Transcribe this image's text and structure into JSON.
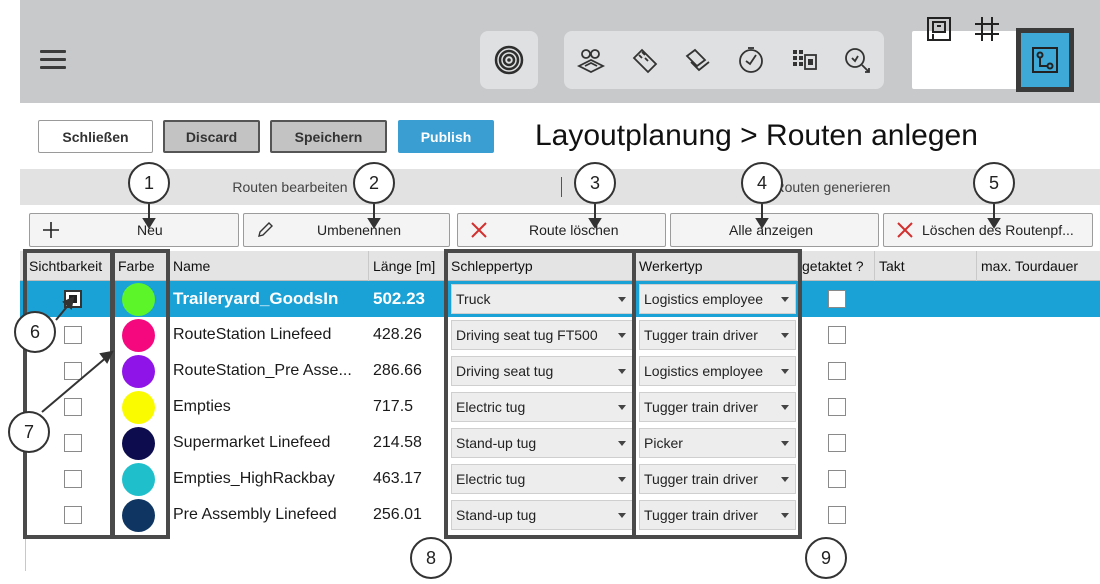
{
  "toolbar": {
    "menu_icon": "hamburger-icon",
    "group1": [
      "radar-icon"
    ],
    "group2": [
      "shapes-icon",
      "ruler-icon",
      "layers-icon",
      "clock-icon",
      "grid-table-icon",
      "search-route-icon"
    ],
    "views": [
      "floorplan-view-icon",
      "grid-view-icon",
      "route-view-icon"
    ],
    "active_view": "route-view-icon"
  },
  "actions": {
    "close": "Schließen",
    "discard": "Discard",
    "save": "Speichern",
    "publish": "Publish"
  },
  "page_title": "Layoutplanung > Routen anlegen",
  "tabs": {
    "edit": "Routen bearbeiten",
    "generate": "Routen generieren"
  },
  "route_toolbar": {
    "new": "Neu",
    "rename": "Umbenennen",
    "delete_route": "Route löschen",
    "show_all": "Alle anzeigen",
    "delete_path": "Löschen des Routenpf..."
  },
  "columns": {
    "visibility": "Sichtbarkeit",
    "color": "Farbe",
    "name": "Name",
    "length": "Länge [m]",
    "tug_type": "Schleppertyp",
    "worker_type": "Werkertyp",
    "clocked": "getaktet ?",
    "cycle": "Takt",
    "max_tour": "max. Tourdauer"
  },
  "rows": [
    {
      "visible": true,
      "color": "#5cf52a",
      "name": "Traileryard_GoodsIn",
      "length": "502.23",
      "tug": "Truck",
      "worker": "Logistics employee",
      "clocked": false,
      "selected": true
    },
    {
      "visible": false,
      "color": "#f5087e",
      "name": "RouteStation Linefeed",
      "length": "428.26",
      "tug": "Driving seat tug FT500",
      "worker": "Tugger train driver",
      "clocked": false,
      "selected": false
    },
    {
      "visible": false,
      "color": "#8e14e8",
      "name": "RouteStation_Pre Asse...",
      "length": "286.66",
      "tug": "Driving seat tug",
      "worker": "Logistics employee",
      "clocked": false,
      "selected": false
    },
    {
      "visible": false,
      "color": "#fbfb00",
      "name": "Empties",
      "length": "717.5",
      "tug": "Electric tug",
      "worker": "Tugger train driver",
      "clocked": false,
      "selected": false
    },
    {
      "visible": false,
      "color": "#0c0c4e",
      "name": "Supermarket Linefeed",
      "length": "214.58",
      "tug": "Stand-up tug",
      "worker": "Picker",
      "clocked": false,
      "selected": false
    },
    {
      "visible": false,
      "color": "#1fc0cc",
      "name": "Empties_HighRackbay",
      "length": "463.17",
      "tug": "Electric tug",
      "worker": "Tugger train driver",
      "clocked": false,
      "selected": false
    },
    {
      "visible": false,
      "color": "#0f3563",
      "name": "Pre Assembly Linefeed",
      "length": "256.01",
      "tug": "Stand-up tug",
      "worker": "Tugger train driver",
      "clocked": false,
      "selected": false
    }
  ],
  "callouts": [
    "1",
    "2",
    "3",
    "4",
    "5",
    "6",
    "7",
    "8",
    "9"
  ]
}
